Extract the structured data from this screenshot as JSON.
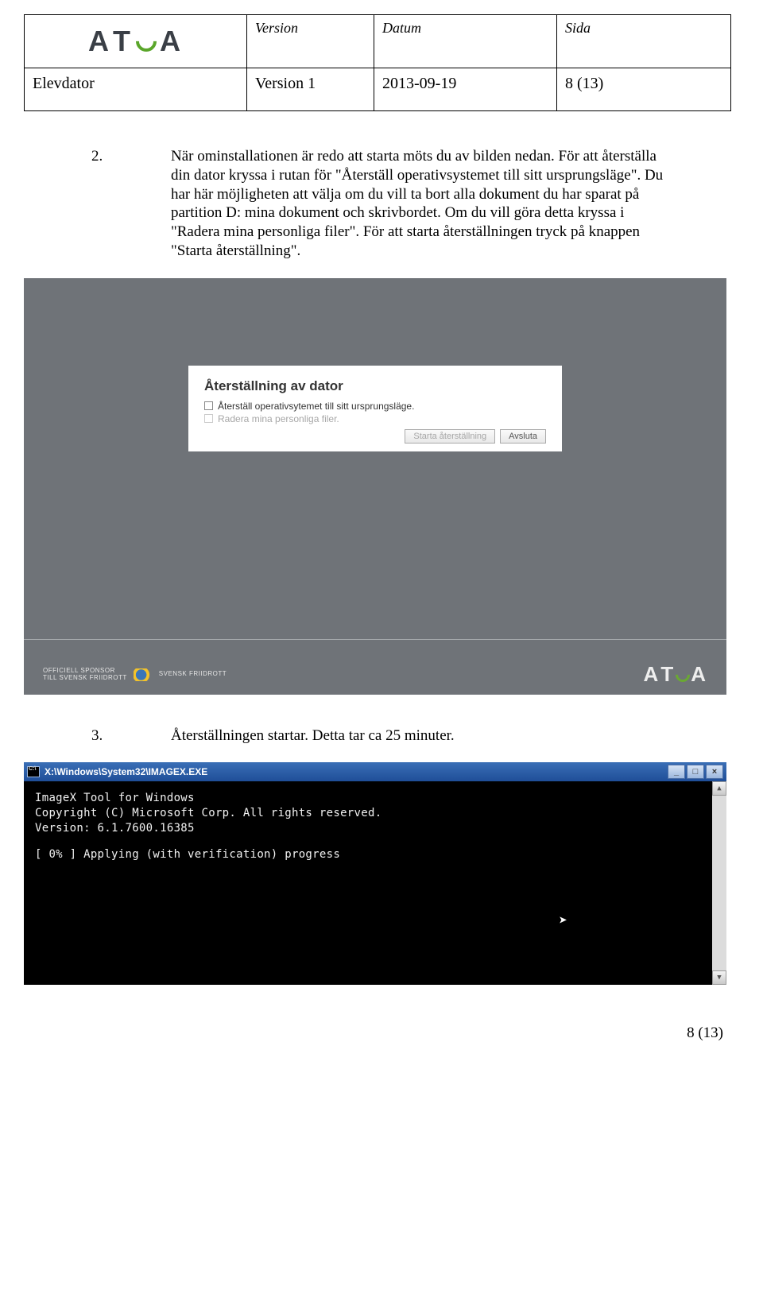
{
  "header": {
    "labels": {
      "version": "Version",
      "date": "Datum",
      "page": "Sida"
    },
    "values": {
      "title": "Elevdator",
      "version": "Version 1",
      "date": "2013-09-19",
      "page": "8 (13)"
    },
    "logo_text": "ATEA"
  },
  "steps": [
    {
      "num": "2.",
      "text": "När ominstallationen är redo att starta möts du av bilden nedan. För att återställa din dator kryssa i rutan för \"Återställ operativsystemet till sitt ursprungsläge\". Du har här möjligheten att välja om du vill ta bort alla dokument du har sparat på partition D: mina dokument och skrivbordet. Om du vill göra detta kryssa i \"Radera mina personliga filer\". För att starta återställningen tryck på knappen \"Starta återställning\"."
    },
    {
      "num": "3.",
      "text": "Återställningen startar. Detta tar ca 25 minuter."
    }
  ],
  "dialog": {
    "title": "Återställning av dator",
    "opt1": "Återställ operativsytemet till sitt ursprungsläge.",
    "opt2": "Radera mina personliga filer.",
    "btn_start": "Starta återställning",
    "btn_close": "Avsluta"
  },
  "screenshot1_footer": {
    "sponsor_line1": "OFFICIELL SPONSOR",
    "sponsor_line2": "TILL SVENSK FRIIDROTT",
    "sponsor_badge": "SVENSK FRIIDROTT",
    "logo": "ATEA"
  },
  "terminal": {
    "title": "X:\\Windows\\System32\\IMAGEX.EXE",
    "lines": [
      "ImageX Tool for Windows",
      "Copyright (C) Microsoft Corp. All rights reserved.",
      "Version: 6.1.7600.16385",
      "",
      "[   0% ] Applying (with verification) progress"
    ],
    "btn_min": "_",
    "btn_max": "□",
    "btn_close": "×",
    "sb_up": "▲",
    "sb_down": "▼"
  },
  "footer_page": "8 (13)"
}
